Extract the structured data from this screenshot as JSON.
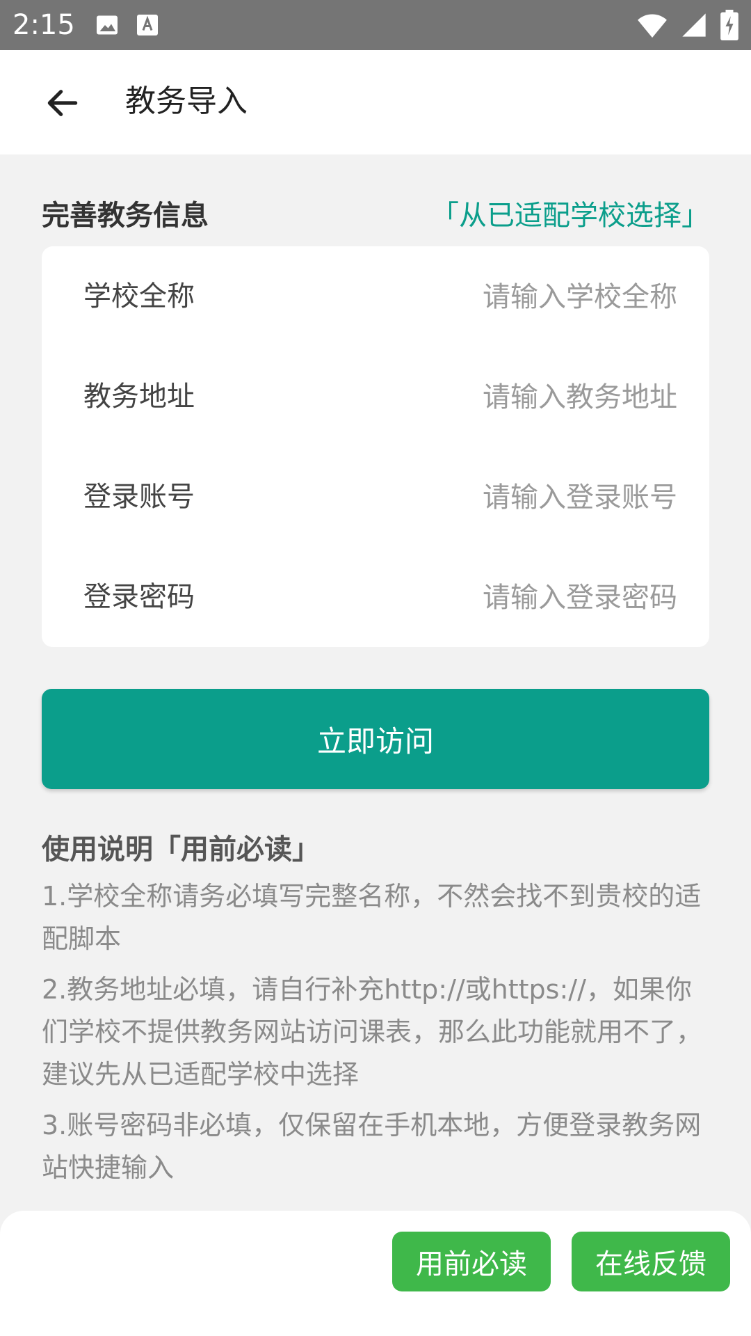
{
  "status_bar": {
    "time": "2:15",
    "icons": [
      "image-icon",
      "font-icon",
      "wifi-icon",
      "signal-icon",
      "battery-charging-icon"
    ]
  },
  "app_bar": {
    "title": "教务导入",
    "back_icon": "arrow-left-icon"
  },
  "section": {
    "title": "完善教务信息",
    "link": "「从已适配学校选择」"
  },
  "form": {
    "fields": [
      {
        "label": "学校全称",
        "placeholder": "请输入学校全称",
        "value": ""
      },
      {
        "label": "教务地址",
        "placeholder": "请输入教务地址",
        "value": ""
      },
      {
        "label": "登录账号",
        "placeholder": "请输入登录账号",
        "value": ""
      },
      {
        "label": "登录密码",
        "placeholder": "请输入登录密码",
        "value": ""
      }
    ]
  },
  "primary_button": "立即访问",
  "instructions": {
    "title": "使用说明「用前必读」",
    "items": [
      "1.学校全称请务必填写完整名称，不然会找不到贵校的适配脚本",
      "2.教务地址必填，请自行补充http://或https://，如果你们学校不提供教务网站访问课表，那么此功能就用不了，建议先从已适配学校中选择",
      "3.账号密码非必填，仅保留在手机本地，方便登录教务网站快捷输入"
    ]
  },
  "bottom_sheet": {
    "read_button": "用前必读",
    "feedback_button": "在线反馈"
  },
  "colors": {
    "accent": "#0b9e8b",
    "sheet_button": "#3fb84a",
    "status_bar": "#757575",
    "background": "#f2f2f2"
  }
}
